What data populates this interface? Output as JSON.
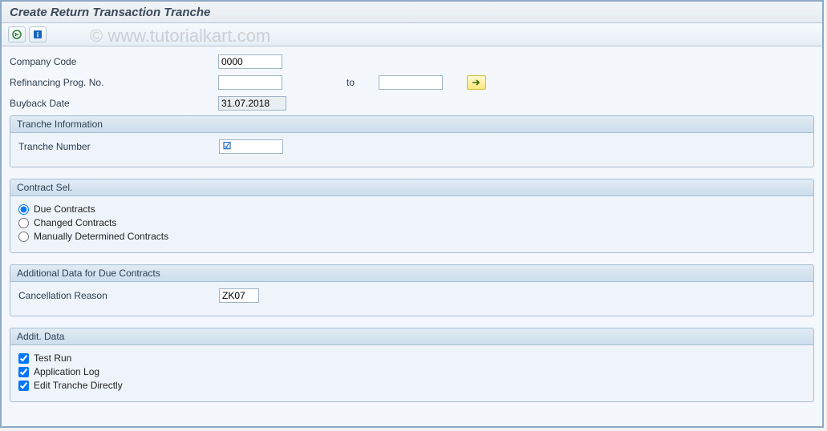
{
  "title": "Create Return Transaction Tranche",
  "watermark": "© www.tutorialkart.com",
  "toolbar": {
    "execute_icon": "execute",
    "info_icon": "info"
  },
  "fields": {
    "company_code": {
      "label": "Company Code",
      "value": "0000"
    },
    "refin_prog_no": {
      "label": "Refinancing Prog. No.",
      "value_from": "",
      "to_label": "to",
      "value_to": ""
    },
    "buyback_date": {
      "label": "Buyback Date",
      "value": "31.07.2018"
    }
  },
  "group_tranche": {
    "title": "Tranche Information",
    "tranche_number": {
      "label": "Tranche Number",
      "value": "",
      "checked_indicator": "☑"
    }
  },
  "group_contract": {
    "title": "Contract Sel.",
    "options": {
      "due": {
        "label": "Due Contracts",
        "selected": true
      },
      "changed": {
        "label": "Changed Contracts",
        "selected": false
      },
      "manual": {
        "label": "Manually Determined Contracts",
        "selected": false
      }
    }
  },
  "group_add_due": {
    "title": "Additional Data for Due Contracts",
    "cancellation_reason": {
      "label": "Cancellation Reason",
      "value": "ZK07"
    }
  },
  "group_addit": {
    "title": "Addit. Data",
    "checks": {
      "test_run": {
        "label": "Test Run",
        "checked": true
      },
      "app_log": {
        "label": "Application Log",
        "checked": true
      },
      "edit_tranche": {
        "label": "Edit Tranche Directly",
        "checked": true
      }
    }
  }
}
